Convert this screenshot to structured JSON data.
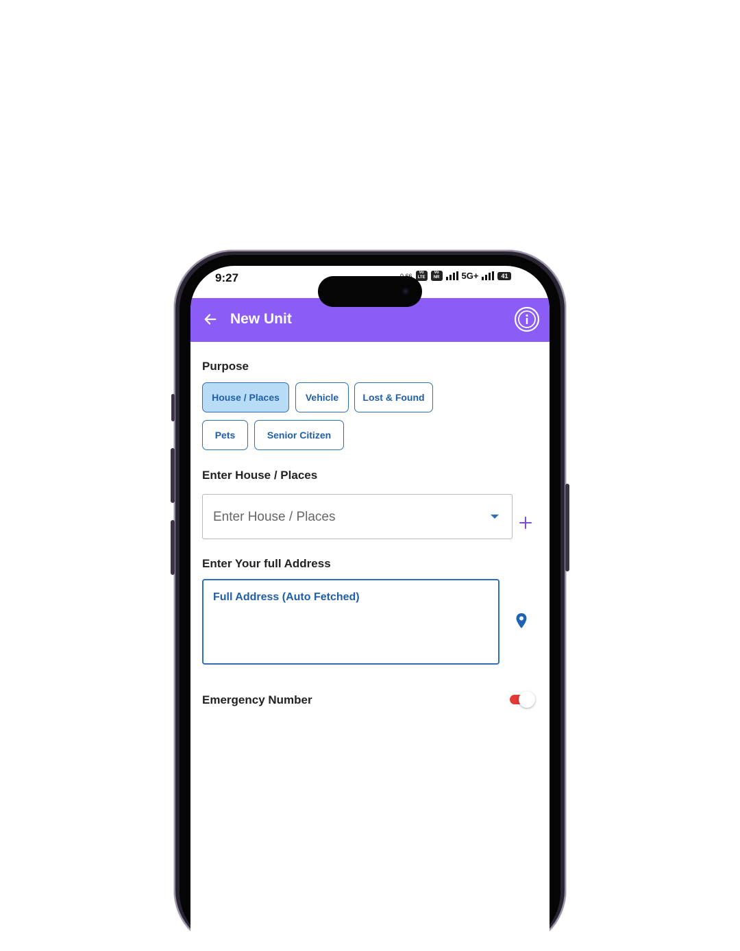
{
  "status_bar": {
    "time": "9:27",
    "speed": "0.66",
    "sim1_label": "Vo 1 LTE",
    "sim2_label": "Vo 2 NR",
    "network": "5G+",
    "battery": "41"
  },
  "app_bar": {
    "title": "New Unit",
    "background_color": "#8b5cf6",
    "back_icon": "arrow-left-icon",
    "info_icon": "info-circle-icon"
  },
  "purpose": {
    "label": "Purpose",
    "options": [
      {
        "label": "House / Places",
        "selected": true
      },
      {
        "label": "Vehicle",
        "selected": false
      },
      {
        "label": "Lost & Found",
        "selected": false
      },
      {
        "label": "Pets",
        "selected": false
      },
      {
        "label": "Senior Citizen",
        "selected": false
      }
    ]
  },
  "house_places": {
    "label": "Enter House / Places",
    "placeholder": "Enter House / Places",
    "add_icon": "plus-icon"
  },
  "address": {
    "label": "Enter Your full Address",
    "placeholder": "Full Address (Auto Fetched)",
    "location_icon": "map-pin-icon"
  },
  "emergency": {
    "label": "Emergency Number",
    "enabled": false,
    "toggle_color": "#e53935"
  }
}
